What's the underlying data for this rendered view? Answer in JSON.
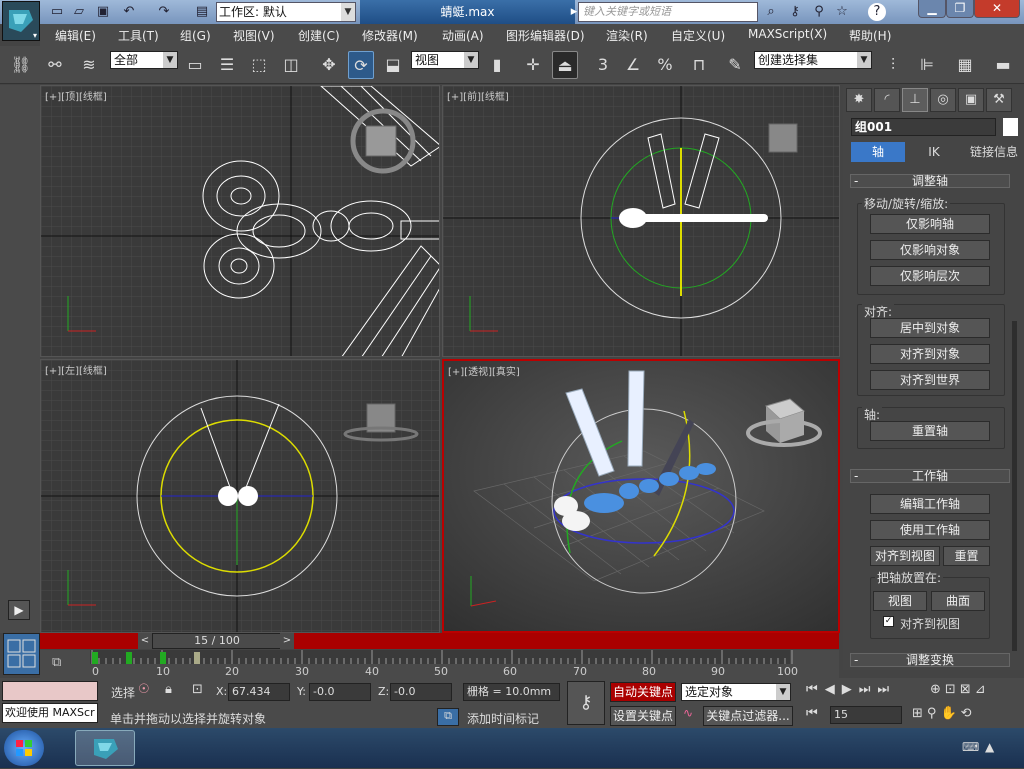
{
  "window": {
    "workspace_label": "工作区: 默认",
    "file_title": "蜻蜓.max",
    "search_placeholder": "键入关键字或短语"
  },
  "menus": [
    "编辑(E)",
    "工具(T)",
    "组(G)",
    "视图(V)",
    "创建(C)",
    "修改器(M)",
    "动画(A)",
    "图形编辑器(D)",
    "渲染(R)",
    "自定义(U)",
    "MAXScript(X)",
    "帮助(H)"
  ],
  "toolbar": {
    "selection_filter": "全部",
    "ref_coord": "视图",
    "named_selection": "创建选择集",
    "snap_3": "3",
    "percent": "%"
  },
  "viewports": {
    "top": {
      "label": "[+][顶][线框]"
    },
    "front": {
      "label": "[+][前][线框]"
    },
    "left": {
      "label": "[+][左][线框]"
    },
    "persp": {
      "label": "[+][透视][真实]"
    }
  },
  "cmdpanel": {
    "object_name": "组001",
    "tabs": {
      "pivot": "轴",
      "ik": "IK",
      "link_info": "链接信息"
    },
    "adjust_pivot": {
      "title": "调整轴",
      "move_group": "移动/旋转/缩放:",
      "affect_pivot": "仅影响轴",
      "affect_object": "仅影响对象",
      "affect_hierarchy": "仅影响层次",
      "align_group": "对齐:",
      "center_to_object": "居中到对象",
      "align_to_object": "对齐到对象",
      "align_to_world": "对齐到世界",
      "pivot_group": "轴:",
      "reset_pivot": "重置轴"
    },
    "working_pivot": {
      "title": "工作轴",
      "edit": "编辑工作轴",
      "use": "使用工作轴",
      "align_to_view": "对齐到视图",
      "reset": "重置",
      "place_group": "把轴放置在:",
      "view": "视图",
      "surface": "曲面",
      "align_to_view_check": "对齐到视图"
    },
    "adjust_transform": {
      "title": "调整变换"
    }
  },
  "timeline": {
    "frame_display": "15 / 100",
    "ticks": [
      "0",
      "10",
      "20",
      "30",
      "40",
      "50",
      "60",
      "70",
      "80",
      "90",
      "100"
    ],
    "current_frame": 15,
    "total_frames": 100
  },
  "status": {
    "welcome": "欢迎使用 MAXScr",
    "select_label": "选择",
    "x_label": "X:",
    "x_value": "67.434",
    "y_label": "Y:",
    "y_value": "-0.0",
    "z_label": "Z:",
    "z_value": "-0.0",
    "grid": "栅格 = 10.0mm",
    "prompt": "单击并拖动以选择并旋转对象",
    "add_time_tag": "添加时间标记",
    "auto_key": "自动关键点",
    "set_key": "设置关键点",
    "key_mode": "选定对象",
    "key_filters": "关键点过滤器...",
    "frame_value": "15"
  },
  "colors": {
    "timeslider_bg": "#aa0000",
    "autokey_bg": "#aa0000",
    "active_viewport_border": "#bb0000",
    "panel_tab_sel": "#3a78c8"
  },
  "icons": [
    "app-logo-icon",
    "new-icon",
    "open-icon",
    "save-icon",
    "undo-icon",
    "redo-icon",
    "search-binoculars-icon",
    "key-icon",
    "star-icon",
    "help-icon",
    "minimize-icon",
    "maximize-icon",
    "close-icon"
  ]
}
